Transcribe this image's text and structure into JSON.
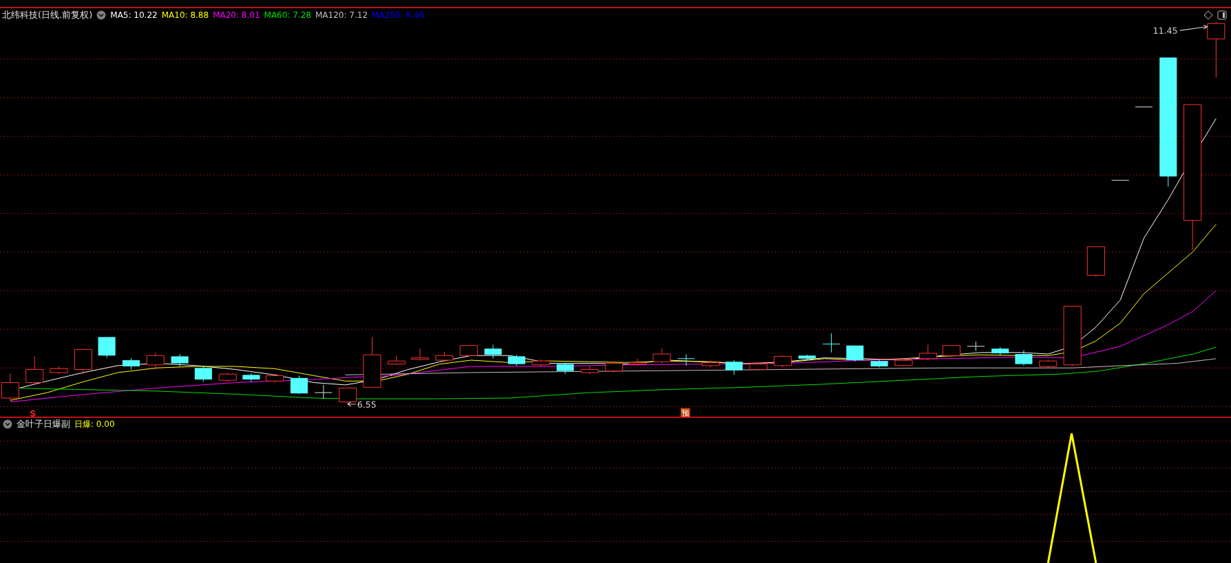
{
  "chart_header": {
    "title": "北纬科技(日线.前复权)",
    "ma_values": [
      {
        "label": "MA5: 10.22",
        "color": "#ffffff"
      },
      {
        "label": "MA10: 8.88",
        "color": "#ffff00"
      },
      {
        "label": "MA20: 8.01",
        "color": "#ff00ff"
      },
      {
        "label": "MA60: 7.28",
        "color": "#00e000"
      },
      {
        "label": "MA120: 7.12",
        "color": "#c0c0c0"
      },
      {
        "label": "MA250: 6.46",
        "color": "#0000ff"
      }
    ]
  },
  "main_chart": {
    "high_label": "11.45",
    "low_label": "6.55",
    "signals": [
      {
        "kind": "sell",
        "text": "S"
      },
      {
        "kind": "forecast",
        "text": "预"
      }
    ]
  },
  "indicator": {
    "title": "金叶子日爆副",
    "value": "日爆: 0.00"
  }
}
